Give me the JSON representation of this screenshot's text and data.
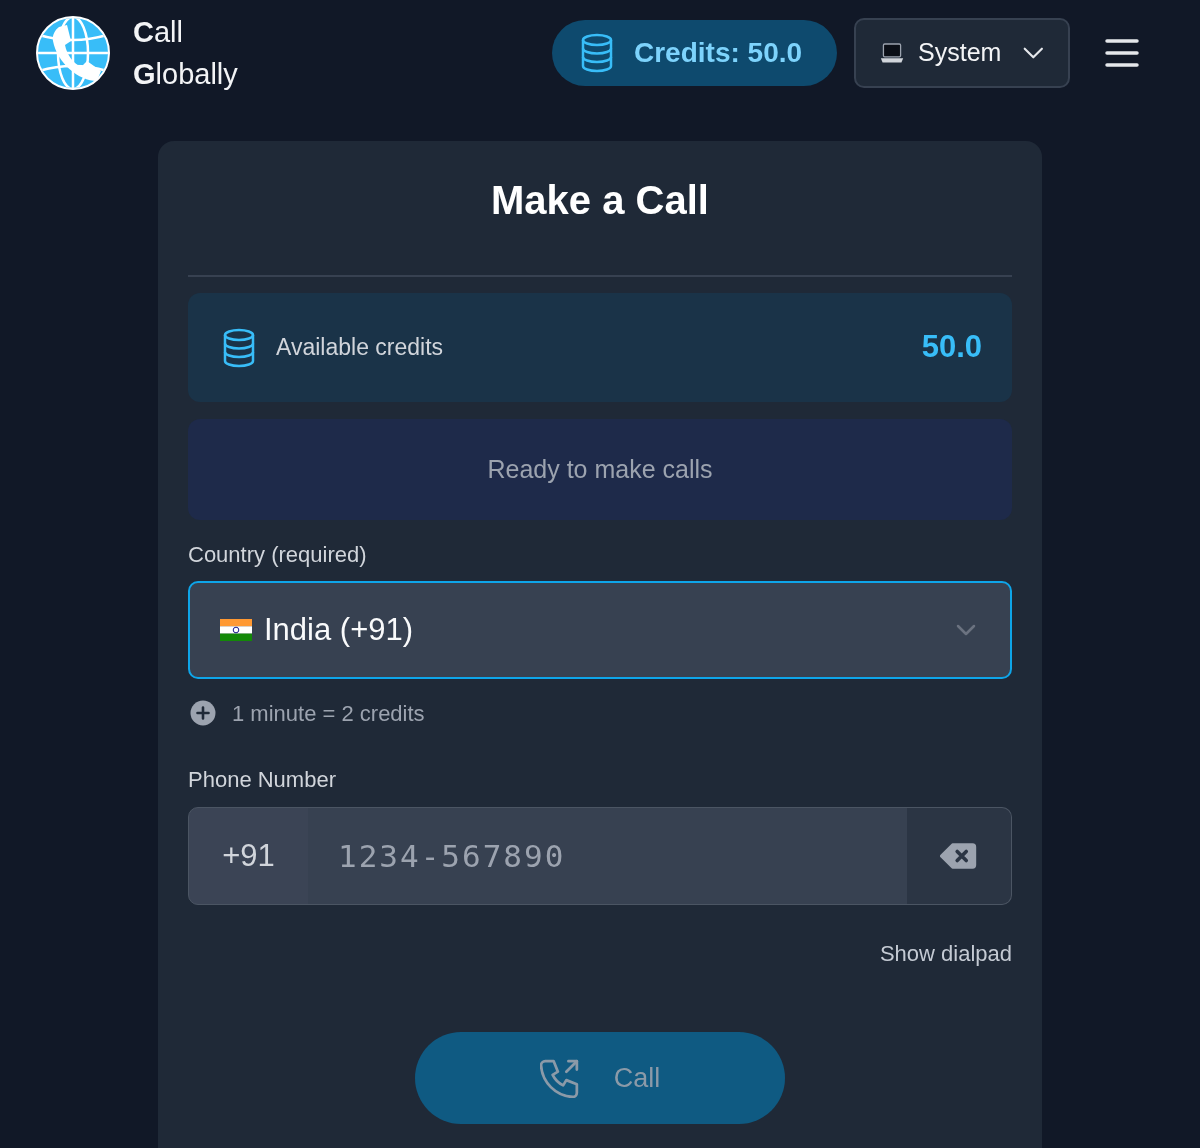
{
  "header": {
    "brand_lines": [
      "**C**all",
      "**G**lobally"
    ],
    "credits_badge": "Credits: 50.0",
    "theme_select": {
      "value": "System"
    }
  },
  "card": {
    "title": "Make a Call",
    "credits_panel": {
      "label": "Available credits",
      "value": "50.0"
    },
    "status": "Ready to make calls",
    "country": {
      "label": "Country (required)",
      "value": "India (+91)",
      "focused": true
    },
    "rate_note": "1 minute = 2 credits",
    "phone": {
      "label": "Phone Number",
      "prefix": "+91",
      "placeholder": "1234-567890"
    },
    "dialpad_toggle": "Show dialpad",
    "call_button": {
      "label": "Call",
      "disabled": true
    }
  }
}
